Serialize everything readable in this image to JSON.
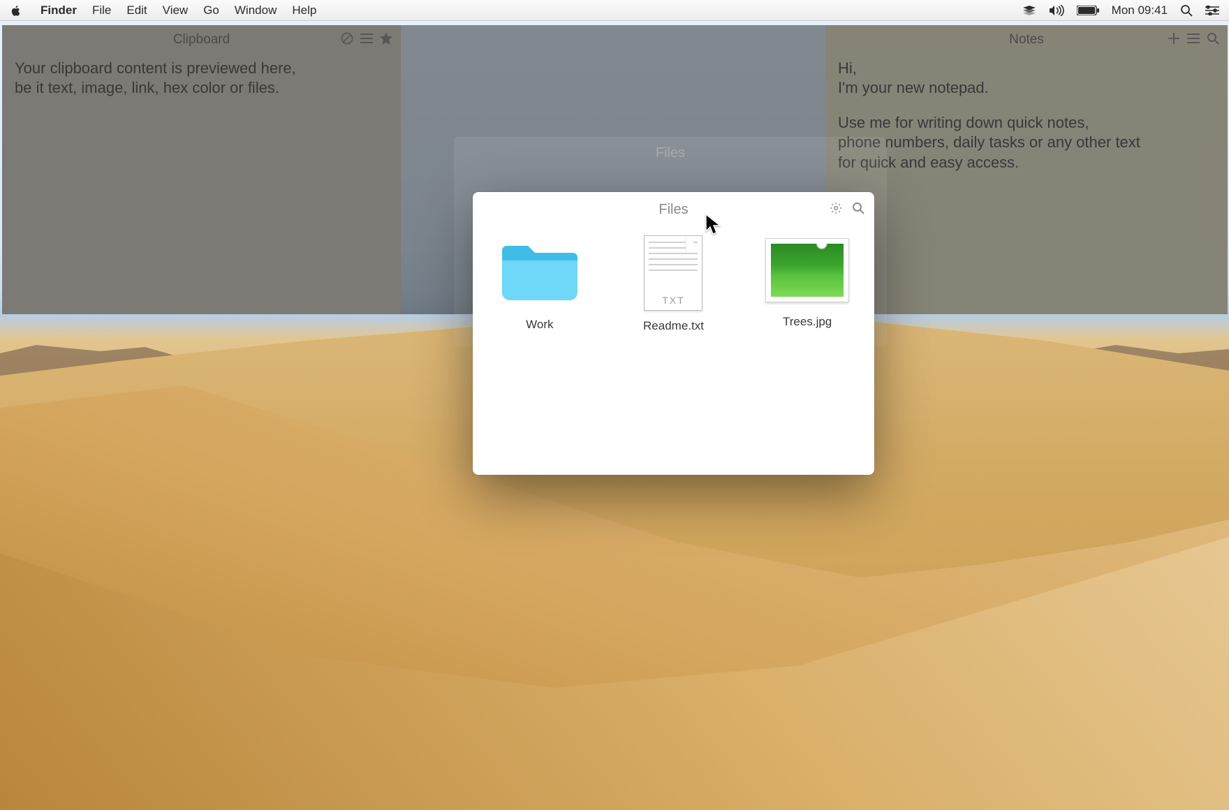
{
  "menubar": {
    "app": "Finder",
    "items": [
      "File",
      "Edit",
      "View",
      "Go",
      "Window",
      "Help"
    ],
    "clock": "Mon 09:41"
  },
  "clipboard": {
    "title": "Clipboard",
    "body": "Your clipboard content is previewed here,\nbe it text, image, link, hex color or files."
  },
  "notes": {
    "title": "Notes",
    "intro": "Hi,\nI'm your new notepad.",
    "body": "Use me for writing down quick notes,\nphone numbers, daily tasks or any other text\nfor quick and easy access."
  },
  "files": {
    "title": "Files",
    "items": [
      {
        "name": "Work",
        "kind": "folder"
      },
      {
        "name": "Readme.txt",
        "kind": "txt",
        "ext": "TXT"
      },
      {
        "name": "Trees.jpg",
        "kind": "image"
      }
    ]
  }
}
